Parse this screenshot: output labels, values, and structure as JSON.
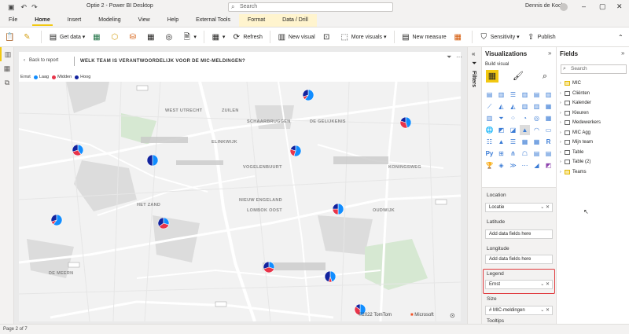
{
  "titlebar": {
    "title": "Optie 2 - Power BI Desktop",
    "search_placeholder": "Search",
    "user": "Dennis de Kock"
  },
  "menu": [
    "File",
    "Home",
    "Insert",
    "Modeling",
    "View",
    "Help",
    "External Tools",
    "Format",
    "Data / Drill"
  ],
  "ribbon": {
    "get_data": "Get data",
    "refresh": "Refresh",
    "new_visual": "New visual",
    "more_visuals": "More visuals",
    "new_measure": "New measure",
    "sensitivity": "Sensitivity",
    "publish": "Publish"
  },
  "report": {
    "back": "Back to report",
    "title": "WELK TEAM IS VERANTWOORDELIJK VOOR DE MIC-MELDINGEN?",
    "legend_title": "Ernst",
    "legend": [
      {
        "label": "Laag",
        "color": "#118dff"
      },
      {
        "label": "Midden",
        "color": "#e8344a"
      },
      {
        "label": "Hoog",
        "color": "#12239e"
      }
    ],
    "copyright": "©2022 TomTom",
    "microsoft": "Microsoft"
  },
  "map": {
    "labels": [
      "WEST UTRECHT",
      "ZUILEN",
      "ELINKWIJK",
      "SCHAARBRUGGEN",
      "DE GELIJKENIS",
      "VOGELENBUURT",
      "KONINGSWEG",
      "HET ZAND",
      "LOMBOK OOST",
      "NIEUW ENGELAND",
      "OUDWIJK",
      "DE MEERN"
    ],
    "pies": [
      {
        "laag": 0.6,
        "midden": 0.1,
        "hoog": 0.3
      },
      {
        "laag": 0.4,
        "midden": 0.3,
        "hoog": 0.3
      },
      {
        "laag": 0.5,
        "midden": 0.0,
        "hoog": 0.5
      },
      {
        "laag": 0.55,
        "midden": 0.25,
        "hoog": 0.2
      },
      {
        "laag": 0.45,
        "midden": 0.35,
        "hoog": 0.2
      },
      {
        "laag": 0.3,
        "midden": 0.35,
        "hoog": 0.35
      },
      {
        "laag": 0.5,
        "midden": 0.25,
        "hoog": 0.25
      },
      {
        "laag": 0.3,
        "midden": 0.4,
        "hoog": 0.3
      },
      {
        "laag": 0.45,
        "midden": 0.1,
        "hoog": 0.45
      },
      {
        "laag": 0.5,
        "midden": 0.35,
        "hoog": 0.15
      },
      {
        "laag": 0.6,
        "midden": 0.1,
        "hoog": 0.3
      }
    ]
  },
  "filters": {
    "label": "Filters"
  },
  "viz": {
    "title": "Visualizations",
    "build": "Build visual",
    "wells": {
      "location": "Location",
      "location_field": "Locatie",
      "latitude": "Latitude",
      "latitude_field": "Add data fields here",
      "longitude": "Longitude",
      "longitude_field": "Add data fields here",
      "legend": "Legend",
      "legend_field": "Ernst",
      "size": "Size",
      "size_field": "# MIC-meldingen",
      "tooltips": "Tooltips"
    }
  },
  "fields": {
    "title": "Fields",
    "search_placeholder": "Search",
    "tables": [
      "MIC",
      "Cliënten",
      "Kalender",
      "Kleuren",
      "Medewerkers",
      "MIC Agg",
      "Mijn team",
      "Table",
      "Table (2)",
      "Teams"
    ]
  },
  "status": {
    "page": "Page 2 of 7"
  }
}
